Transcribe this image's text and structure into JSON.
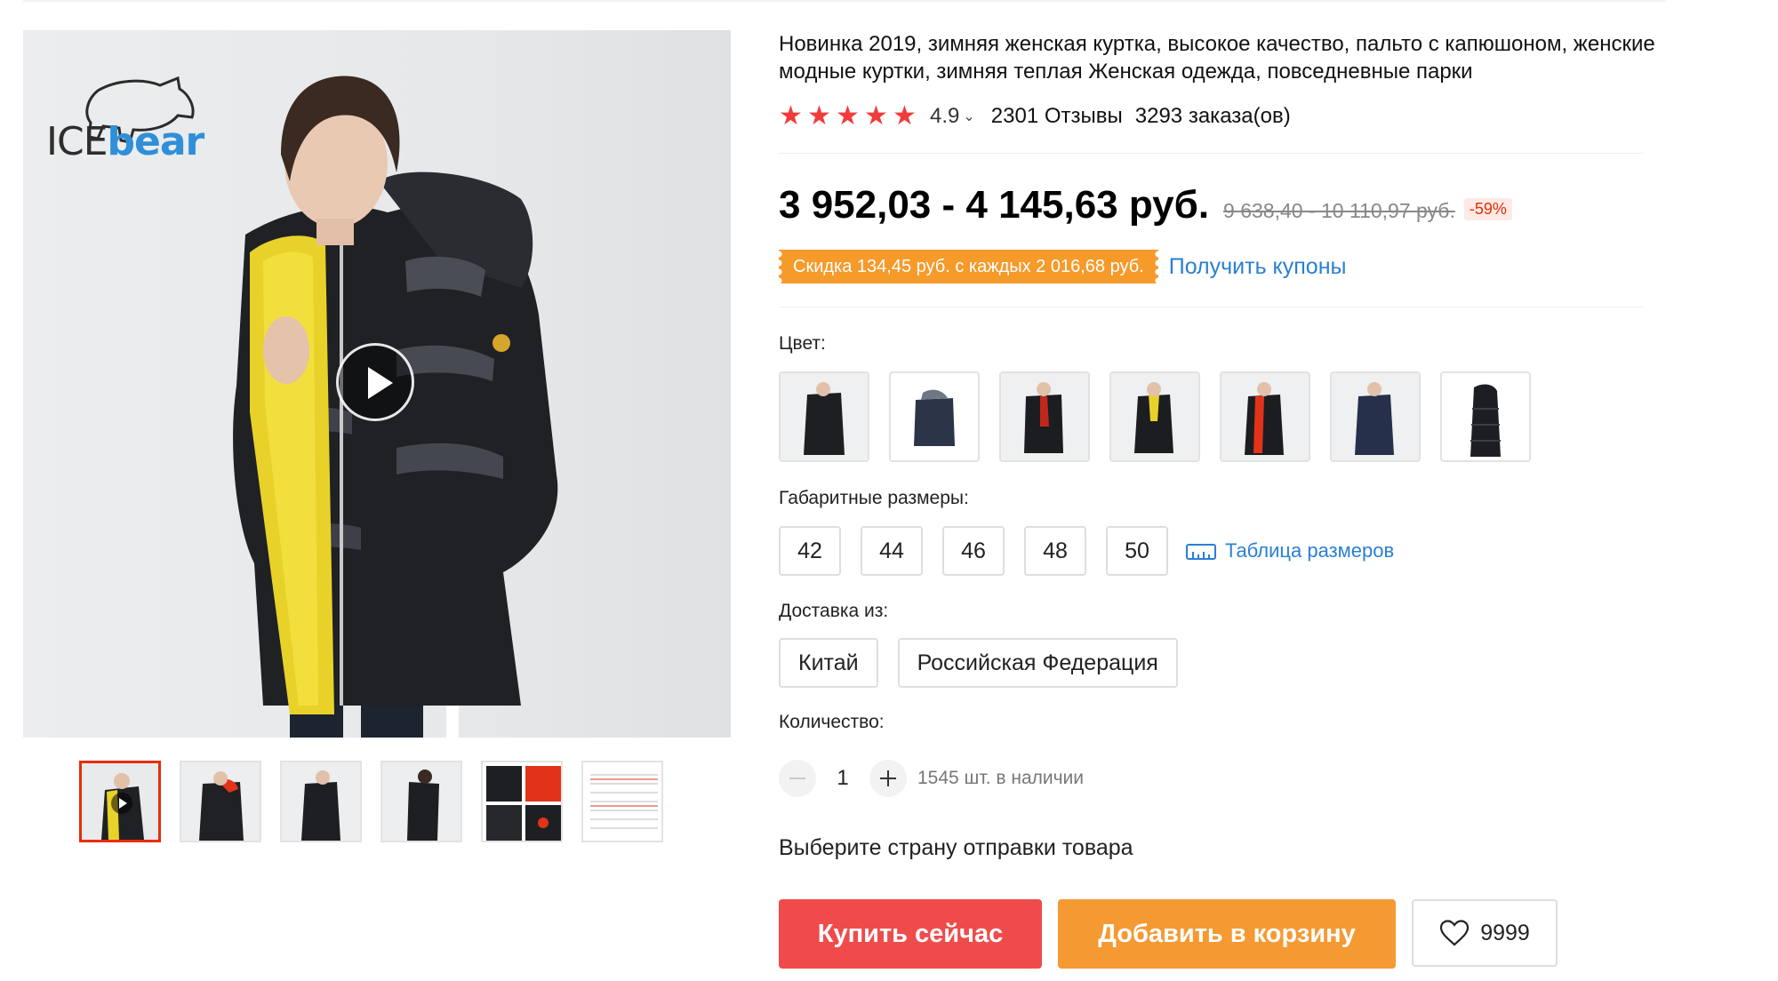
{
  "product": {
    "brand_logo_text_ice": "ICE",
    "brand_logo_text_bear": "bear",
    "title": "Новинка 2019, зимняя женская куртка, высокое качество, пальто с капюшоном, женские модные куртки, зимняя теплая Женская одежда, повседневные парки"
  },
  "gallery": {
    "thumbnails": [
      {
        "name": "thumb-1",
        "active": true,
        "video": true
      },
      {
        "name": "thumb-2"
      },
      {
        "name": "thumb-3"
      },
      {
        "name": "thumb-4"
      },
      {
        "name": "thumb-5"
      },
      {
        "name": "thumb-6"
      }
    ]
  },
  "rating": {
    "stars": 5,
    "value": "4.9",
    "reviews": "2301 Отзывы",
    "orders": "3293 заказа(ов)"
  },
  "price": {
    "current": "3 952,03 - 4 145,63 руб.",
    "original": "9 638,40 - 10 110,97 руб.",
    "discount": "-59%"
  },
  "coupon": {
    "tag": "Скидка 134,45 руб. с каждых 2 016,68 руб.",
    "link": "Получить купоны"
  },
  "color": {
    "label": "Цвет:",
    "swatch_count": 7
  },
  "size": {
    "label": "Габаритные размеры:",
    "options": [
      "42",
      "44",
      "46",
      "48",
      "50"
    ],
    "chart_link": "Таблица размеров"
  },
  "shipping": {
    "label": "Доставка из:",
    "options": [
      "Китай",
      "Российская Федерация"
    ],
    "note": "Выберите страну отправки товара"
  },
  "quantity": {
    "label": "Количество:",
    "value": "1",
    "stock": "1545 шт. в наличии"
  },
  "actions": {
    "buy": "Купить сейчас",
    "cart": "Добавить в корзину",
    "wishlist_count": "9999"
  },
  "colors": {
    "accent_red": "#f04b4b",
    "accent_orange": "#f59a33",
    "link_blue": "#2a7fd4",
    "star_red": "#f03c3c"
  }
}
